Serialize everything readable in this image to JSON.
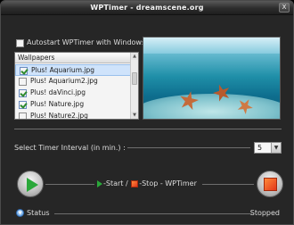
{
  "window": {
    "title": "WPTimer - dreamscene.org",
    "buttons": {
      "close": "X"
    }
  },
  "autostart": {
    "label": "Autostart WPTimer with Windows",
    "checked": false
  },
  "wallpapers": {
    "header": "Wallpapers",
    "items": [
      {
        "name": "Plus! Aquarium.jpg",
        "checked": true,
        "selected": true
      },
      {
        "name": "Plus! Aquarium2.jpg",
        "checked": false,
        "selected": false
      },
      {
        "name": "Plus! daVinci.jpg",
        "checked": true,
        "selected": false
      },
      {
        "name": "Plus! Nature.jpg",
        "checked": true,
        "selected": false
      },
      {
        "name": "Plus! Nature2.jpg",
        "checked": false,
        "selected": false
      }
    ]
  },
  "timer": {
    "label": "Select Timer Interval (in min.) :",
    "value": "5"
  },
  "controls": {
    "legend_start": "-Start /",
    "legend_stop": "-Stop - WPTimer"
  },
  "status": {
    "label": "Status",
    "value": "Stopped"
  },
  "icons": {
    "close": "close-icon",
    "play": "play-icon",
    "stop": "stop-icon",
    "status": "chevron-down-icon"
  },
  "colors": {
    "background": "#262626",
    "play": "#2aa83a",
    "stop": "#e2361a"
  }
}
